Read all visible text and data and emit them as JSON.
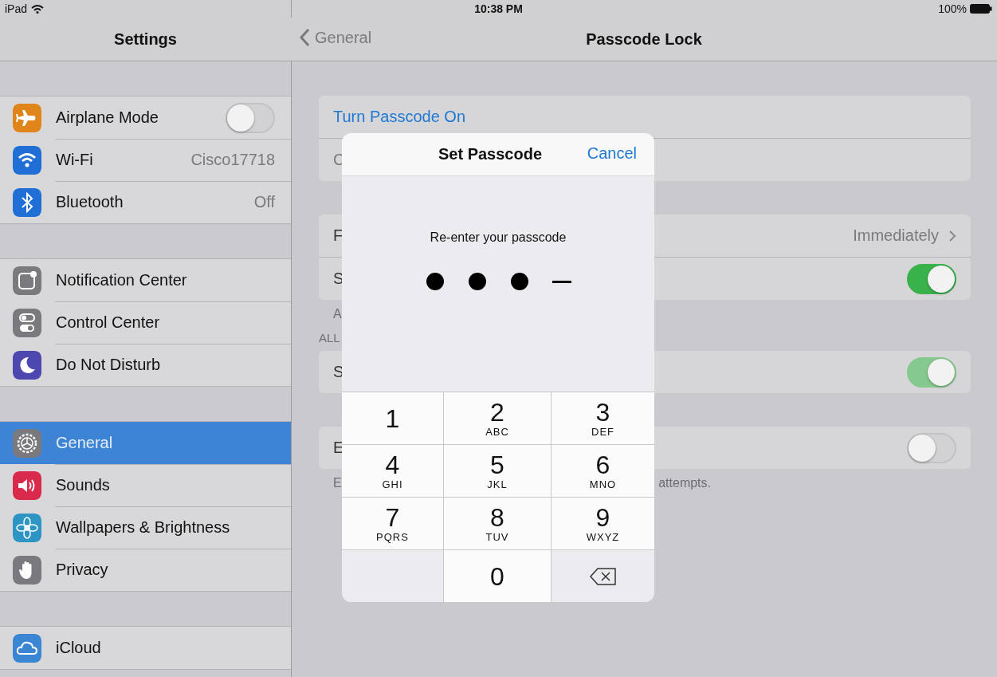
{
  "status_bar": {
    "device": "iPad",
    "time": "10:38 PM",
    "battery": "100%"
  },
  "sidebar": {
    "title": "Settings",
    "groups": [
      [
        {
          "kind": "airplane",
          "color": "#e0851a",
          "label": "Airplane Mode",
          "toggle": {
            "on": false
          },
          "selected": false
        },
        {
          "kind": "wifi",
          "color": "#1f6fd6",
          "label": "Wi-Fi",
          "value": "Cisco17718",
          "selected": false
        },
        {
          "kind": "bluetooth",
          "color": "#1f6fd6",
          "label": "Bluetooth",
          "value": "Off",
          "selected": false
        }
      ],
      [
        {
          "kind": "notification",
          "color": "#7a7a7e",
          "label": "Notification Center",
          "selected": false
        },
        {
          "kind": "control",
          "color": "#7a7a7e",
          "label": "Control Center",
          "selected": false
        },
        {
          "kind": "moon",
          "color": "#4d47b0",
          "label": "Do Not Disturb",
          "selected": false
        }
      ],
      [
        {
          "kind": "gear",
          "color": "#7a7a7e",
          "label": "General",
          "selected": true
        },
        {
          "kind": "speaker",
          "color": "#d92a4c",
          "label": "Sounds",
          "selected": false
        },
        {
          "kind": "flower",
          "color": "#2d95c4",
          "label": "Wallpapers & Brightness",
          "selected": false
        },
        {
          "kind": "hand",
          "color": "#7a7a7e",
          "label": "Privacy",
          "selected": false
        }
      ],
      [
        {
          "kind": "cloud",
          "color": "#3b86d2",
          "label": "iCloud",
          "selected": false
        }
      ]
    ]
  },
  "detail": {
    "back": "General",
    "title": "Passcode Lock",
    "sections": [
      {
        "rows": [
          {
            "kind": "action",
            "label": "Turn Passcode On"
          },
          {
            "kind": "text",
            "label": "C"
          }
        ]
      },
      {
        "rows": [
          {
            "kind": "value",
            "label": "F",
            "value": "Immediately",
            "chevron": true
          },
          {
            "kind": "toggle",
            "label": "S",
            "toggle": {
              "on": true
            }
          }
        ],
        "footer": {
          "left": "A"
        }
      },
      {
        "header": "ALL",
        "rows": [
          {
            "kind": "toggle",
            "label": "S",
            "toggle": {
              "on": true,
              "disabled": true
            }
          }
        ]
      },
      {
        "rows": [
          {
            "kind": "toggle",
            "label": "E",
            "toggle": {
              "on": false
            }
          }
        ],
        "footer": {
          "left": "E",
          "right": "attempts."
        }
      }
    ]
  },
  "modal": {
    "title": "Set Passcode",
    "cancel": "Cancel",
    "prompt": "Re-enter your passcode",
    "slots": [
      {
        "filled": true
      },
      {
        "filled": true
      },
      {
        "filled": true
      },
      {
        "filled": false
      }
    ],
    "keys": [
      {
        "kind": "digit",
        "digit": "1"
      },
      {
        "kind": "digit",
        "digit": "2",
        "letters": "ABC"
      },
      {
        "kind": "digit",
        "digit": "3",
        "letters": "DEF"
      },
      {
        "kind": "digit",
        "digit": "4",
        "letters": "GHI"
      },
      {
        "kind": "digit",
        "digit": "5",
        "letters": "JKL"
      },
      {
        "kind": "digit",
        "digit": "6",
        "letters": "MNO"
      },
      {
        "kind": "digit",
        "digit": "7",
        "letters": "PQRS"
      },
      {
        "kind": "digit",
        "digit": "8",
        "letters": "TUV"
      },
      {
        "kind": "digit",
        "digit": "9",
        "letters": "WXYZ"
      },
      {
        "kind": "blank"
      },
      {
        "kind": "digit",
        "digit": "0"
      },
      {
        "kind": "delete"
      }
    ]
  }
}
